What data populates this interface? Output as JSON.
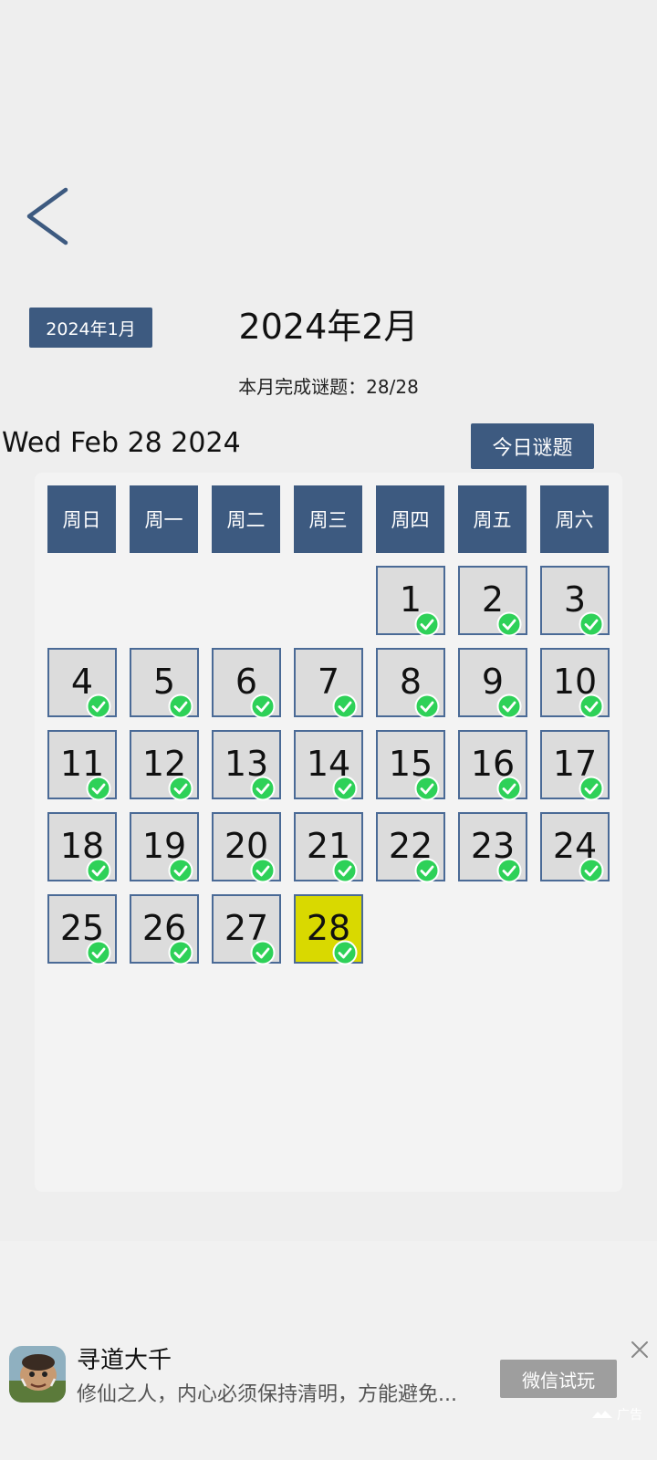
{
  "nav": {
    "back_icon": "chevron-left-icon"
  },
  "header": {
    "prev_month_label": "2024年1月",
    "month_title": "2024年2月",
    "progress_text": "本月完成谜题：28/28"
  },
  "today": {
    "date_text": "Wed Feb 28 2024",
    "puzzle_button": "今日谜题"
  },
  "calendar": {
    "weekdays": [
      "周日",
      "周一",
      "周二",
      "周三",
      "周四",
      "周五",
      "周六"
    ],
    "first_weekday_index": 4,
    "days": [
      {
        "day": "1",
        "completed": true
      },
      {
        "day": "2",
        "completed": true
      },
      {
        "day": "3",
        "completed": true
      },
      {
        "day": "4",
        "completed": true
      },
      {
        "day": "5",
        "completed": true
      },
      {
        "day": "6",
        "completed": true
      },
      {
        "day": "7",
        "completed": true
      },
      {
        "day": "8",
        "completed": true
      },
      {
        "day": "9",
        "completed": true
      },
      {
        "day": "10",
        "completed": true
      },
      {
        "day": "11",
        "completed": true
      },
      {
        "day": "12",
        "completed": true
      },
      {
        "day": "13",
        "completed": true
      },
      {
        "day": "14",
        "completed": true
      },
      {
        "day": "15",
        "completed": true
      },
      {
        "day": "16",
        "completed": true
      },
      {
        "day": "17",
        "completed": true
      },
      {
        "day": "18",
        "completed": true
      },
      {
        "day": "19",
        "completed": true
      },
      {
        "day": "20",
        "completed": true
      },
      {
        "day": "21",
        "completed": true
      },
      {
        "day": "22",
        "completed": true
      },
      {
        "day": "23",
        "completed": true
      },
      {
        "day": "24",
        "completed": true
      },
      {
        "day": "25",
        "completed": true
      },
      {
        "day": "26",
        "completed": true
      },
      {
        "day": "27",
        "completed": true
      },
      {
        "day": "28",
        "completed": true,
        "today": true
      }
    ]
  },
  "colors": {
    "accent": "#3d5a80",
    "today_highlight": "#d9d900",
    "check_green": "#2ed158"
  },
  "ad": {
    "title": "寻道大千",
    "description": "修仙之人，内心必须保持清明，方能避免...",
    "cta": "微信试玩",
    "badge": "广告"
  }
}
